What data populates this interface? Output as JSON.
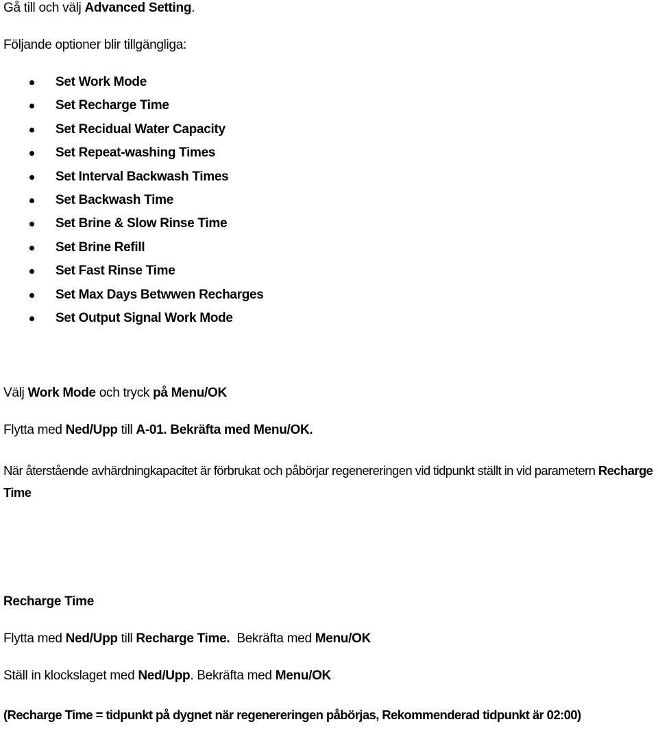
{
  "intro": {
    "prefix": "Gå till och välj ",
    "bold": "Advanced Setting",
    "suffix": "."
  },
  "options_heading": "Följande optioner blir tillgängliga:",
  "options": [
    "Set Work Mode",
    "Set Recharge Time",
    "Set Recidual Water Capacity",
    "Set Repeat-washing Times",
    "Set Interval Backwash Times",
    "Set Backwash Time",
    "Set Brine & Slow Rinse Time",
    "Set Brine Refill",
    "Set Fast Rinse Time",
    "Set Max Days Betwwen Recharges",
    "Set Output Signal Work Mode"
  ],
  "step_work_mode": {
    "t1": "Välj ",
    "b1": "Work Mode",
    "t2": " och tryck ",
    "b2": "på Menu/OK"
  },
  "step_move_a01": {
    "t1": "Flytta med ",
    "b1": "Ned/Upp",
    "t2": " till ",
    "b2": "A-01. Bekräfta med Menu/OK."
  },
  "explanation": {
    "text": "När återstående avhärdningkapacitet är förbrukat och påbörjar regenereringen vid tidpunkt  ställt in vid parametern ",
    "bold": "Recharge Time"
  },
  "recharge_heading": "Recharge Time",
  "step_move_recharge": {
    "t1": "Flytta med ",
    "b1": "Ned/Upp",
    "t2": " till ",
    "b2": "Recharge Time.",
    "t3": "  Bekräfta med ",
    "b3": "Menu/OK"
  },
  "step_set_clock": {
    "t1": "Ställ in klockslaget med ",
    "b1": "Ned/Upp",
    "t2": ". Bekräfta med ",
    "b2": "Menu/OK"
  },
  "note": "(Recharge Time = tidpunkt på dygnet när regenereringen påbörjas, Rekommenderad tidpunkt är 02:00)"
}
